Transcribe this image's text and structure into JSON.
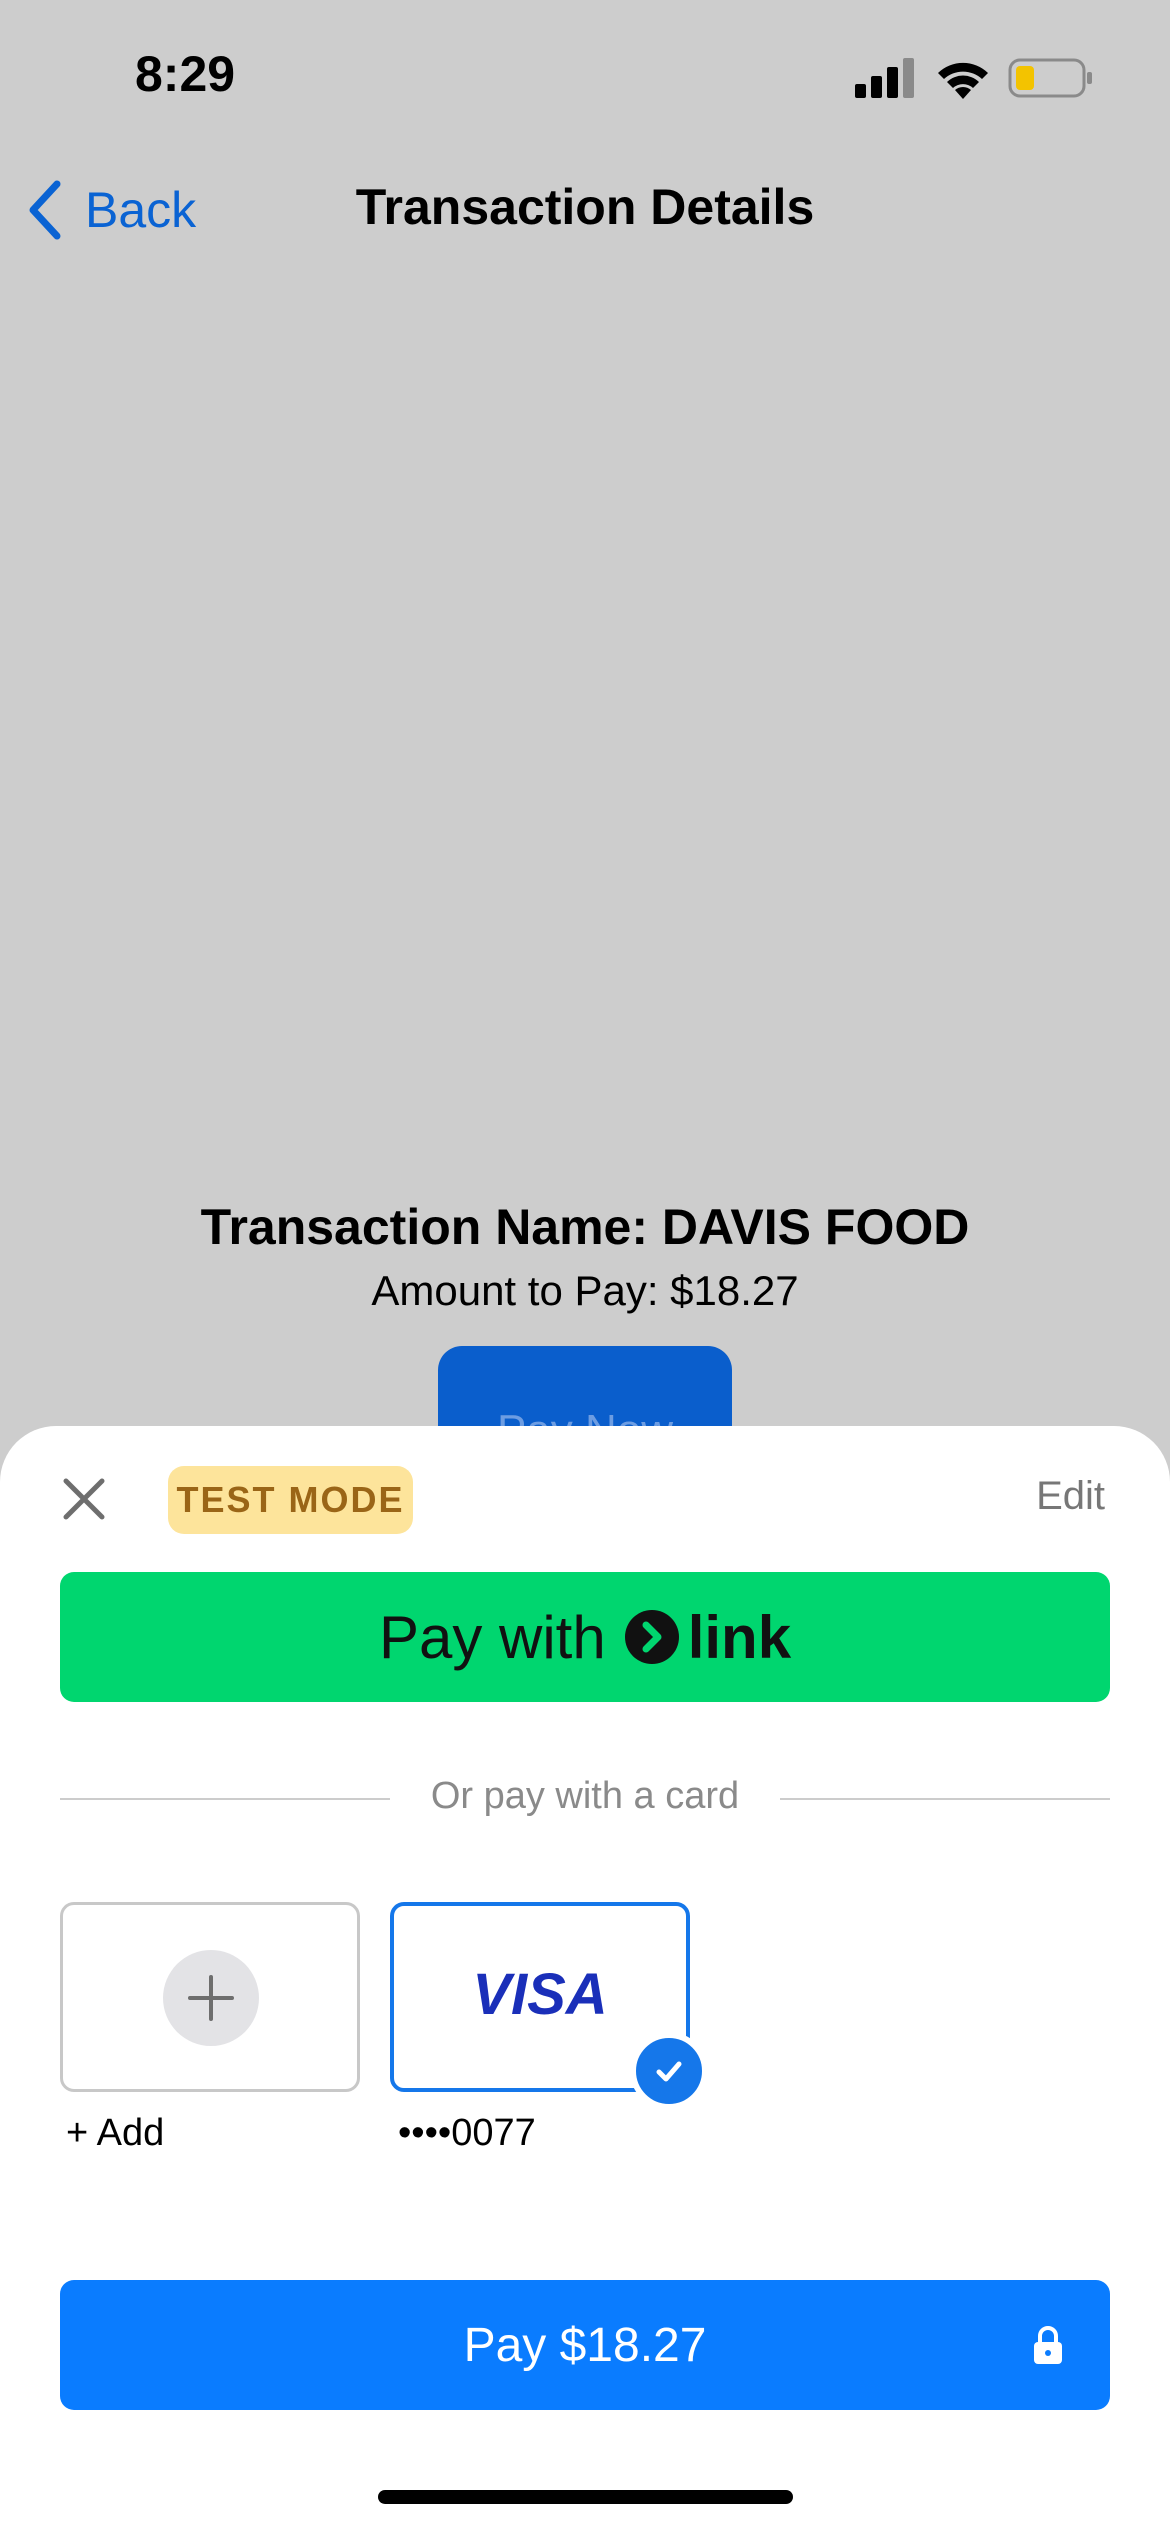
{
  "status_bar": {
    "time": "8:29"
  },
  "nav": {
    "back_label": "Back",
    "title": "Transaction Details"
  },
  "transaction": {
    "name_line": "Transaction Name: DAVIS FOOD",
    "amount_line": "Amount to Pay: $18.27",
    "pay_now_label": "Pay Now"
  },
  "sheet": {
    "test_mode_label": "TEST MODE",
    "edit_label": "Edit",
    "link_button_prefix": "Pay with",
    "link_brand": "link",
    "divider_text": "Or pay with a card",
    "add_label": "+ Add",
    "card_brand": "VISA",
    "card_label": "••••0077",
    "pay_button_label": "Pay $18.27"
  },
  "colors": {
    "link_green": "#00d66f",
    "pay_blue": "#0a7cff",
    "nav_blue": "#0a63d3",
    "badge_bg": "#fde49b"
  },
  "icons": [
    "back-chevron-icon",
    "close-icon",
    "plus-icon",
    "checkmark-icon",
    "lock-icon",
    "link-arrow-icon",
    "cellular-signal-icon",
    "wifi-icon",
    "battery-icon"
  ]
}
